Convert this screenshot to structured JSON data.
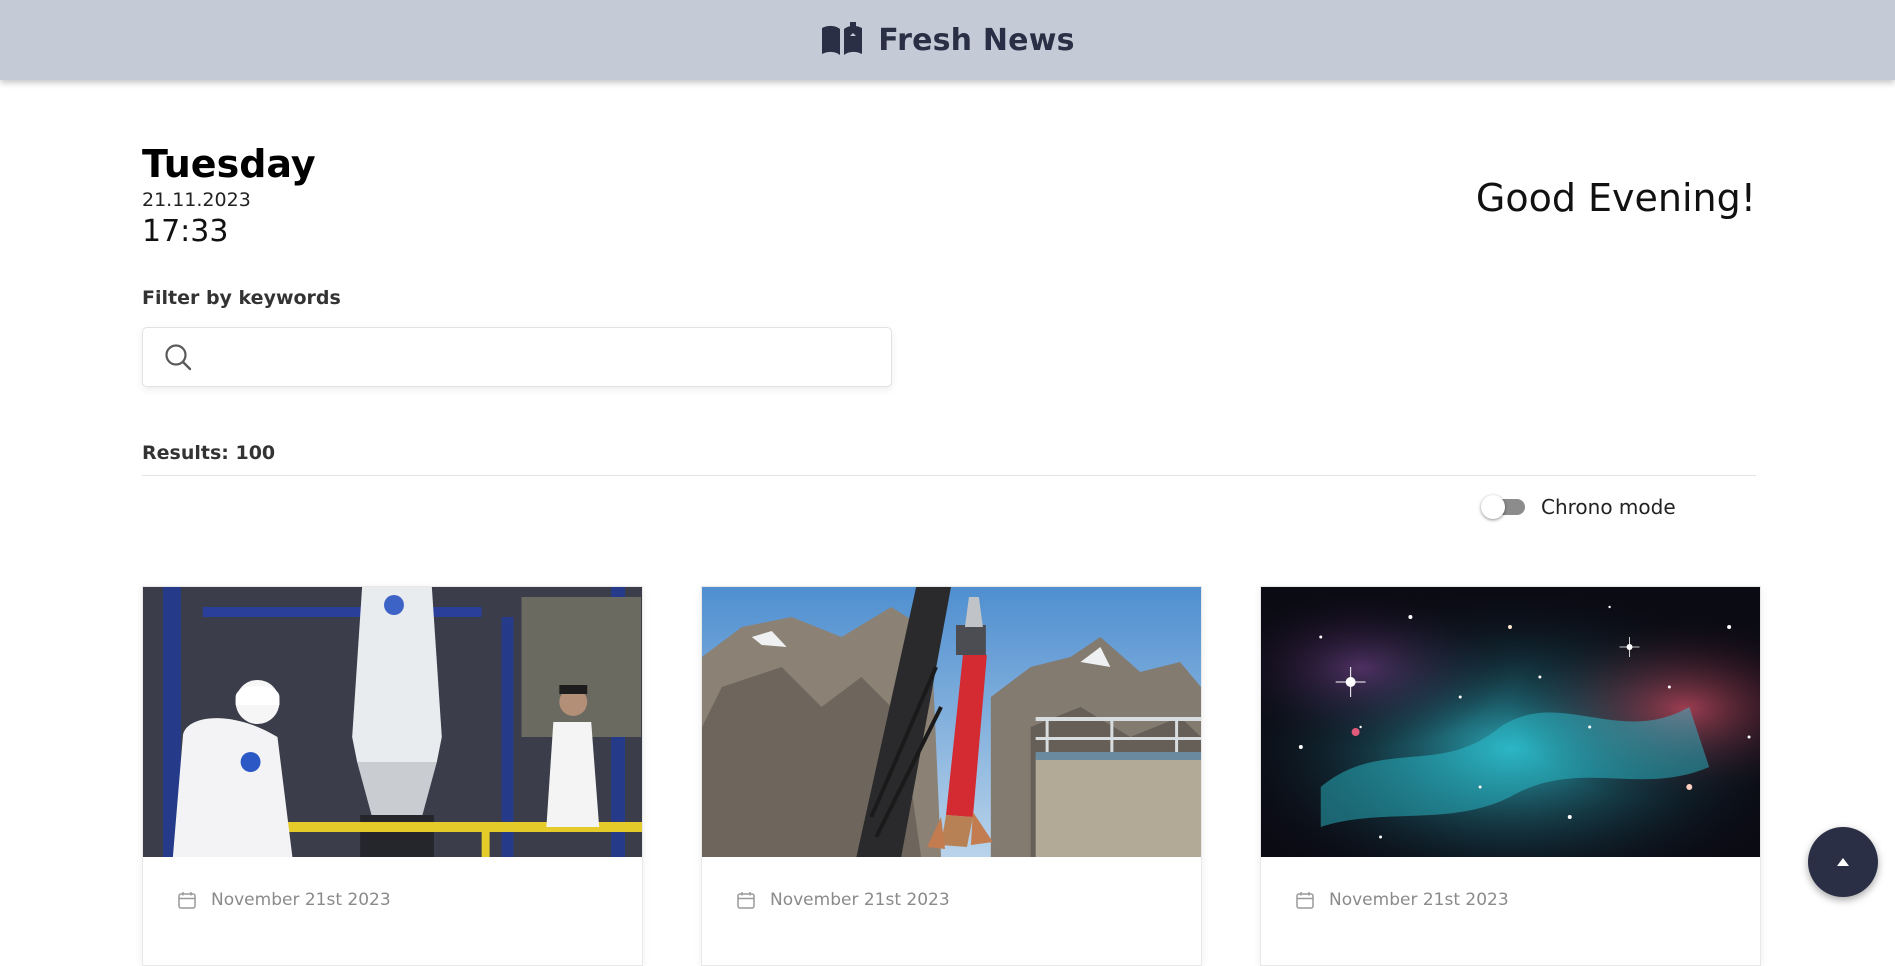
{
  "header": {
    "title": "Fresh News",
    "logo_icon": "open-book-icon"
  },
  "datetime": {
    "day": "Tuesday",
    "date": "21.11.2023",
    "time": "17:33"
  },
  "greeting": "Good Evening!",
  "filter": {
    "label": "Filter by keywords",
    "value": "",
    "placeholder": "",
    "icon": "search-icon"
  },
  "results": {
    "text": "Results: 100",
    "count": 100
  },
  "chrono_mode": {
    "label": "Chrono mode",
    "enabled": false
  },
  "cards": [
    {
      "date": "November 21st 2023",
      "image_subject": "rocket capsule in assembly hall"
    },
    {
      "date": "November 21st 2023",
      "image_subject": "red rocket on launch tower in mountains"
    },
    {
      "date": "November 21st 2023",
      "image_subject": "starfield nebula"
    }
  ],
  "colors": {
    "header_bg": "#c5cbd6",
    "brand": "#2b2f45",
    "toggle_off": "#8c8c8c"
  },
  "scroll_top_icon": "arrow-up-icon"
}
